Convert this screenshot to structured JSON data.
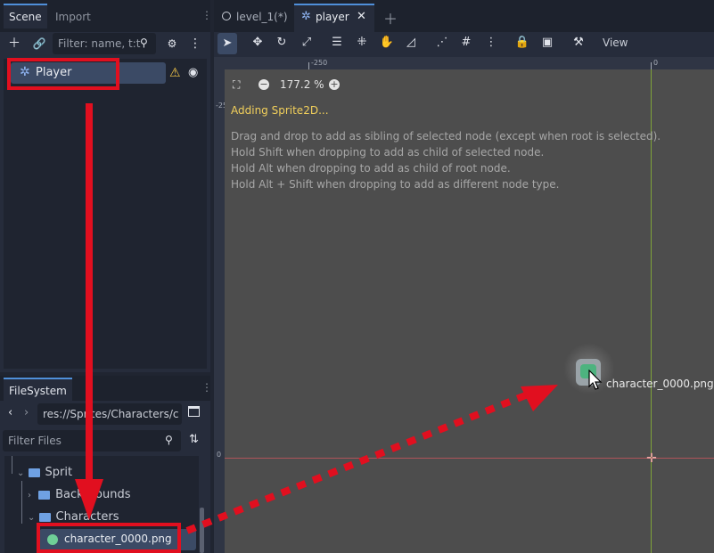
{
  "scene_dock": {
    "tabs": [
      "Scene",
      "Import"
    ],
    "filter_placeholder": "Filter: name, t:t",
    "root_node": "Player"
  },
  "filesystem": {
    "tab": "FileSystem",
    "path": "res://Sprites/Characters/c",
    "filter_placeholder": "Filter Files",
    "items": [
      "Sprit",
      "Backgrounds",
      "Characters",
      "character_0000.png"
    ]
  },
  "editor": {
    "tabs": [
      "level_1(*)",
      "player"
    ],
    "view_label": "View",
    "zoom": "177.2 %",
    "status_title": "Adding Sprite2D...",
    "help_lines": [
      "Drag and drop to add as sibling of selected node (except when root is selected).",
      "Hold Shift when dropping to add as child of selected node.",
      "Hold Alt when dropping to add as child of root node.",
      "Hold Alt + Shift when dropping to add as different node type."
    ],
    "ruler_labels": [
      "-250",
      "0",
      "-250",
      "0"
    ],
    "drag_file": "character_0000.png"
  },
  "colors": {
    "accent": "#4f8fd9",
    "annotation_red": "#e10f1f",
    "warning": "#f7c948"
  }
}
